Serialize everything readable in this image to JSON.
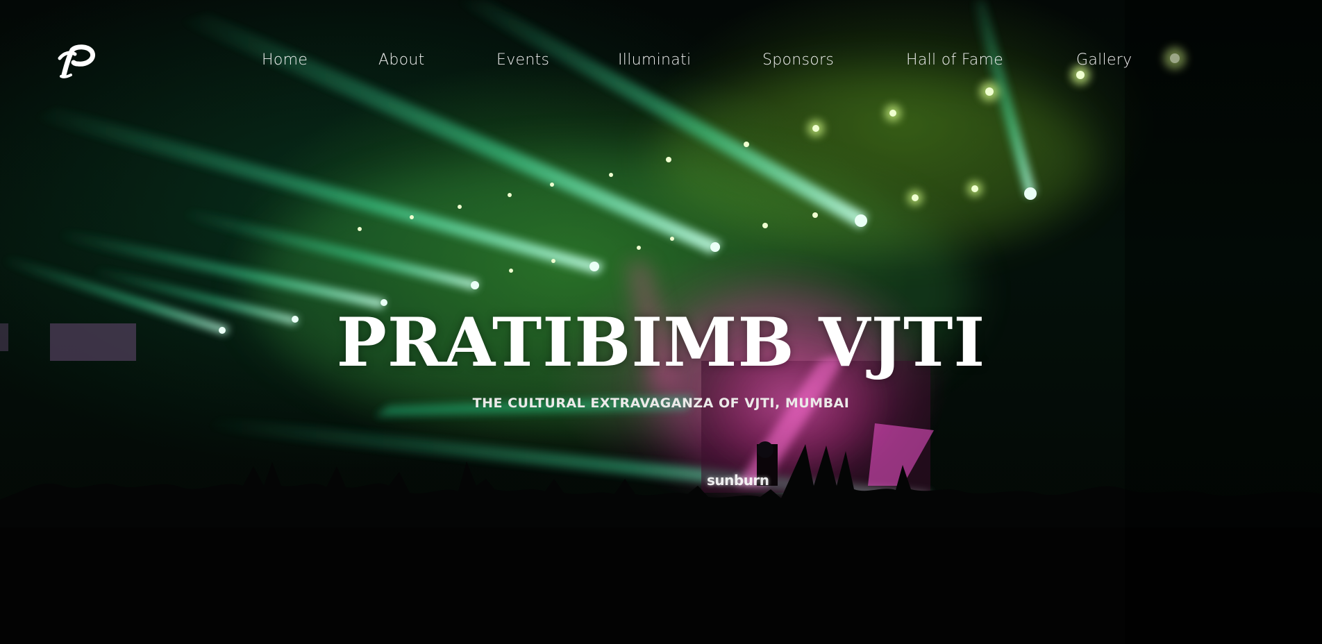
{
  "brand": {
    "logo_icon": "pratibimb-p-logo-icon"
  },
  "nav": {
    "items": [
      {
        "label": "Home"
      },
      {
        "label": "About"
      },
      {
        "label": "Events"
      },
      {
        "label": "Illuminati"
      },
      {
        "label": "Sponsors"
      },
      {
        "label": "Hall of Fame"
      },
      {
        "label": "Gallery"
      }
    ]
  },
  "hero": {
    "title": "PRATIBIMB VJTI",
    "subtitle": "THE CULTURAL EXTRAVAGANZA OF VJTI, MUMBAI",
    "stage_sign": "sunburn"
  },
  "colors": {
    "beam_green": "#5dffb4",
    "light_yellow_green": "#c9ff6a",
    "stage_pink": "#e0409a",
    "text_white": "#ffffff"
  }
}
